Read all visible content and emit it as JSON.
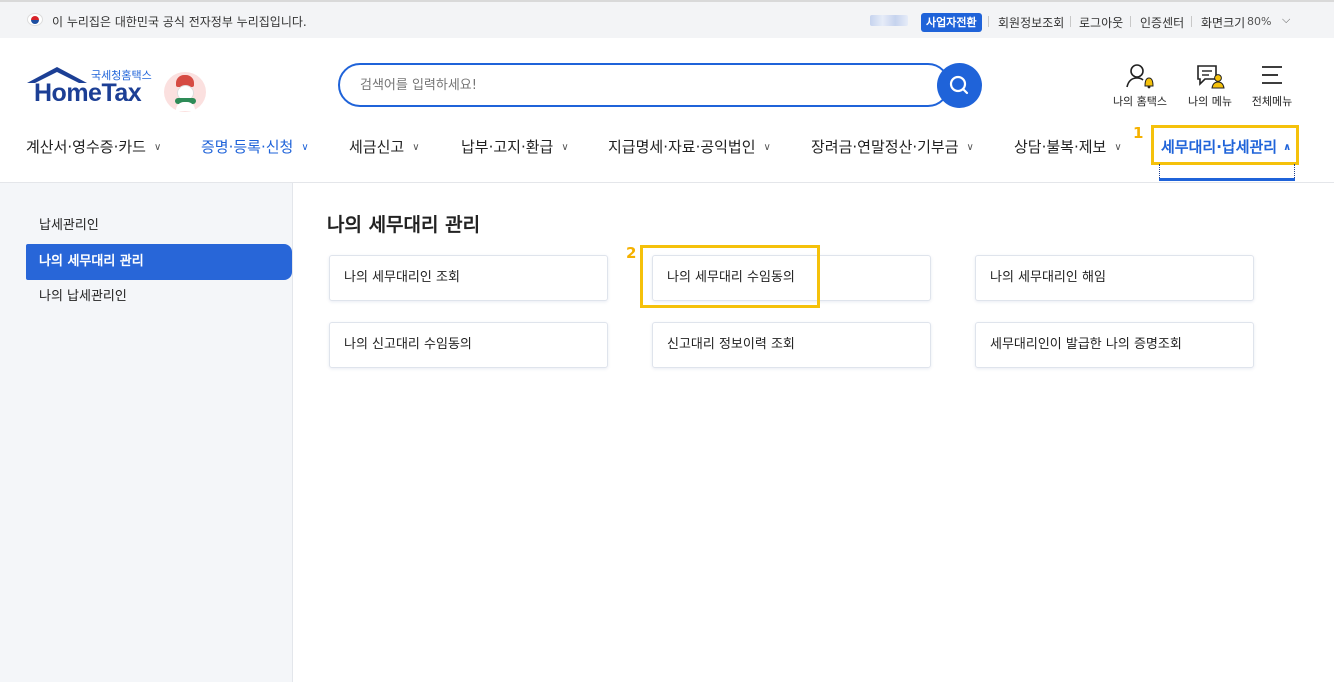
{
  "topbar": {
    "gov_notice": "이 누리집은 대한민국 공식 전자정부 누리집입니다.",
    "business_switch": "사업자전환",
    "links": [
      "회원정보조회",
      "로그아웃",
      "인증센터"
    ],
    "zoom_label": "화면크기",
    "zoom_value": "80%"
  },
  "logo": {
    "subtitle": "국세청홈택스",
    "title": "HomeTax"
  },
  "search": {
    "placeholder": "검색어를 입력하세요!"
  },
  "header_icons": [
    {
      "label": "나의 홈택스",
      "icon": "user-bell-icon"
    },
    {
      "label": "나의 메뉴",
      "icon": "my-menu-icon"
    },
    {
      "label": "전체메뉴",
      "icon": "hamburger-icon"
    }
  ],
  "gnb": [
    {
      "label": "계산서·영수증·카드",
      "state": "normal"
    },
    {
      "label": "증명·등록·신청",
      "state": "active"
    },
    {
      "label": "세금신고",
      "state": "normal"
    },
    {
      "label": "납부·고지·환급",
      "state": "normal"
    },
    {
      "label": "지급명세·자료·공익법인",
      "state": "normal"
    },
    {
      "label": "장려금·연말정산·기부금",
      "state": "normal"
    },
    {
      "label": "상담·불복·제보",
      "state": "normal"
    },
    {
      "label": "세무대리·납세관리",
      "state": "open"
    }
  ],
  "annotations": {
    "step1": "1",
    "step2": "2",
    "highlight_color": "#f5c10a"
  },
  "sidebar": {
    "items": [
      {
        "label": "납세관리인",
        "active": false
      },
      {
        "label": "나의 세무대리 관리",
        "active": true
      },
      {
        "label": "나의 납세관리인",
        "active": false
      }
    ]
  },
  "main": {
    "title": "나의 세무대리 관리",
    "cards": [
      "나의 세무대리인 조회",
      "나의 세무대리 수임동의",
      "나의 세무대리인 해임",
      "나의 신고대리 수임동의",
      "신고대리 정보이력 조회",
      "세무대리인이 발급한 나의 증명조회"
    ]
  },
  "colors": {
    "brand_blue": "#1f63d9",
    "logo_navy": "#1c3f95",
    "sidebar_active": "#2866d8"
  }
}
